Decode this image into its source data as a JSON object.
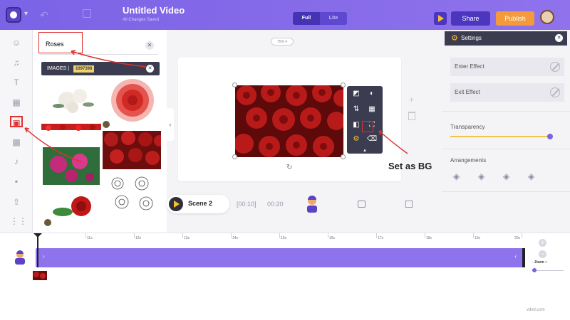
{
  "header": {
    "title": "Untitled Video",
    "subtitle": "All Changes Saved",
    "view_modes": [
      "Full",
      "Lite"
    ],
    "share_label": "Share",
    "publish_label": "Publish",
    "colors": {
      "header": "#7b63e6",
      "publish": "#f59a3b",
      "dark": "#3c3c51"
    }
  },
  "library": {
    "search_value": "Roses",
    "category_label": "IMAGES",
    "separator": "|",
    "result_count": "1097396"
  },
  "canvas": {
    "zoom": "75%",
    "annotation": "Set as BG"
  },
  "scene": {
    "label": "Scene 2",
    "duration_bracket": "[00:10]",
    "time": "00:20"
  },
  "settings": {
    "title": "Settings",
    "enter_effect": "Enter Effect",
    "exit_effect": "Exit Effect",
    "transparency_label": "Transparency",
    "transparency_value": 1.0,
    "arrangements_label": "Arrangements"
  },
  "timeline": {
    "ticks": [
      "11s",
      "12s",
      "13s",
      "14s",
      "15s",
      "16s",
      "17s",
      "18s",
      "19s",
      "20s"
    ],
    "zoom_label": "Zoom"
  },
  "watermark": "vdvd.com"
}
